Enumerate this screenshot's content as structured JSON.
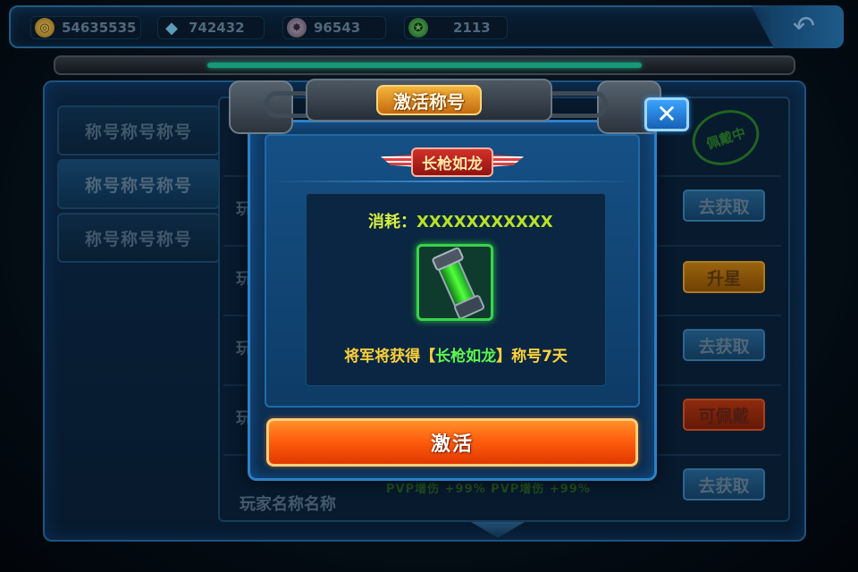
{
  "resources": [
    {
      "icon": "gold-coin-icon",
      "value": "54635535"
    },
    {
      "icon": "diamond-icon",
      "value": "742432"
    },
    {
      "icon": "ore-icon",
      "value": "96543"
    },
    {
      "icon": "medal-icon",
      "value": "2113"
    }
  ],
  "back_glyph": "↶",
  "tabs": [
    "称号称号称号",
    "称号称号称号",
    "称号称号称号"
  ],
  "rows": [
    {
      "label": "玩",
      "button": "去获取"
    },
    {
      "label": "玩",
      "button": "升星"
    },
    {
      "label": "玩",
      "button": "去获取"
    },
    {
      "label": "玩",
      "button": "可佩戴"
    },
    {
      "label": "",
      "button": "去获取"
    }
  ],
  "equipped_stamp": "佩戴中",
  "footer_name": "玩家名称名称",
  "pvp_text": "PVP增伤 +99%   PVP增伤 +99%",
  "dialog": {
    "header": "激活称号",
    "close_glyph": "✕",
    "title_name": "长枪如龙",
    "cost_key": "消耗：",
    "cost_value": "XXXXXXXXXXX",
    "desc_prefix": "将军将获得【",
    "desc_name": "长枪如龙",
    "desc_suffix": "】称号7天",
    "activate_label": "激活"
  },
  "colors": {
    "accent_blue": "#2a82c8",
    "highlight_green": "#5ff84a",
    "desc_yellow": "#ffd23a",
    "activate_orange": "#ff5f0e"
  }
}
